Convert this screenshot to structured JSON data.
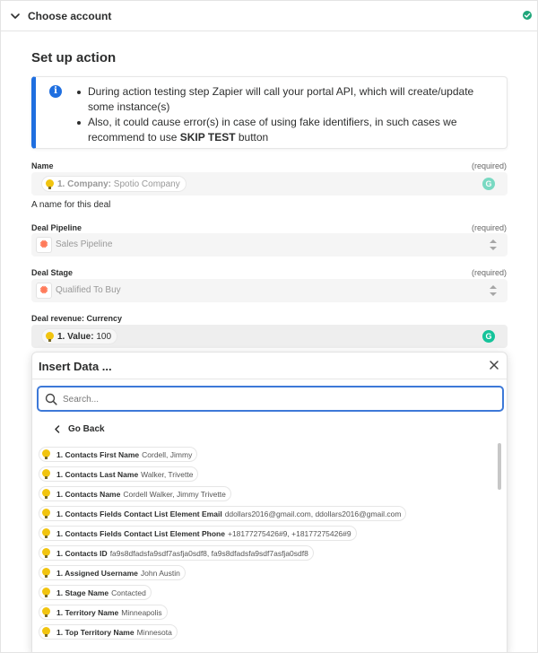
{
  "accordion": {
    "title": "Choose account",
    "status": "complete"
  },
  "section_title": "Set up action",
  "info": {
    "bullets": [
      "During action testing step Zapier will call your portal API, which will create/update some instance(s)",
      "Also, it could cause error(s) in case of using fake identifiers, in such cases we recommend to use"
    ],
    "bullet2_emphasis": "SKIP TEST",
    "bullet2_suffix": " button"
  },
  "fields": {
    "name": {
      "label": "Name",
      "required": "(required)",
      "pill_label": "1. Company:",
      "pill_value": "Spotio Company",
      "helper": "A name for this deal"
    },
    "deal_pipeline": {
      "label": "Deal Pipeline",
      "required": "(required)",
      "value": "Sales Pipeline"
    },
    "deal_stage": {
      "label": "Deal Stage",
      "required": "(required)",
      "value": "Qualified To Buy"
    },
    "deal_revenue": {
      "label": "Deal revenue: Currency",
      "pill_label": "1. Value:",
      "pill_value": "100"
    }
  },
  "insert_data": {
    "title": "Insert Data ...",
    "search_placeholder": "Search...",
    "go_back": "Go Back",
    "items": [
      {
        "label": "1. Contacts First Name",
        "value": "Cordell, Jimmy"
      },
      {
        "label": "1. Contacts Last Name",
        "value": "Walker, Trivette"
      },
      {
        "label": "1. Contacts Name",
        "value": "Cordell Walker, Jimmy Trivette"
      },
      {
        "label": "1. Contacts Fields Contact List Element Email",
        "value": "ddollars2016@gmail.com, ddollars2016@gmail.com"
      },
      {
        "label": "1. Contacts Fields Contact List Element Phone",
        "value": "+18177275426#9, +18177275426#9"
      },
      {
        "label": "1. Contacts ID",
        "value": "fa9s8dfadsfa9sdf7asfja0sdf8, fa9s8dfadsfa9sdf7asfja0sdf8"
      },
      {
        "label": "1. Assigned Username",
        "value": "John Austin"
      },
      {
        "label": "1. Stage Name",
        "value": "Contacted"
      },
      {
        "label": "1. Territory Name",
        "value": "Minneapolis"
      },
      {
        "label": "1. Top Territory Name",
        "value": "Minnesota"
      }
    ]
  },
  "colors": {
    "accent": "#1f6fe0",
    "search_border": "#3d79d8",
    "bulb": "#f1c40f",
    "hubspot": "#ff7a59",
    "grammarly": "#15c39a",
    "success": "#1fa67a"
  },
  "icons": [
    "chevron-down-icon",
    "check-icon",
    "info-icon",
    "lightbulb-icon",
    "grammarly-icon",
    "hubspot-icon",
    "sort-icon",
    "close-icon",
    "search-icon",
    "chevron-left-icon"
  ]
}
